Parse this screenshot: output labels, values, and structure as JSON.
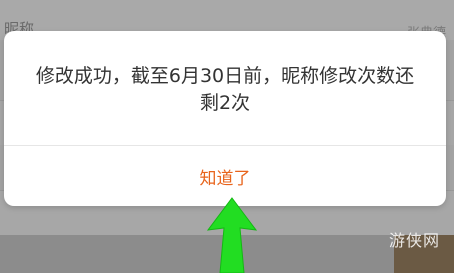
{
  "background": {
    "title_left": "昵称",
    "title_right": "张典德"
  },
  "dialog": {
    "message": "修改成功，截至6月30日前，昵称修改次数还剩2次",
    "confirm_label": "知道了"
  },
  "colors": {
    "accent": "#e8641c",
    "arrow": "#22dd22"
  },
  "watermark": "游侠网"
}
